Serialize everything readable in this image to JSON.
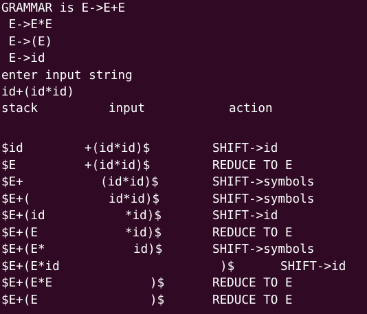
{
  "terminal": {
    "header_lines": [
      "GRAMMAR is E->E+E",
      " E->E*E",
      " E->(E)",
      " E->id",
      "enter input string",
      "id+(id*id)"
    ],
    "columns": {
      "stack": "stack",
      "input": "input",
      "action": "action"
    },
    "rows": [
      {
        "stack": "$id",
        "input": "+(id*id)$",
        "action": "SHIFT->id"
      },
      {
        "stack": "$E",
        "input": "+(id*id)$",
        "action": "REDUCE TO E"
      },
      {
        "stack": "$E+",
        "input": "(id*id)$",
        "action": "SHIFT->symbols"
      },
      {
        "stack": "$E+(",
        "input": "id*id)$",
        "action": "SHIFT->symbols"
      },
      {
        "stack": "$E+(id",
        "input": "*id)$",
        "action": "SHIFT->id"
      },
      {
        "stack": "$E+(E",
        "input": "*id)$",
        "action": "REDUCE TO E"
      },
      {
        "stack": "$E+(E*",
        "input": "id)$",
        "action": "SHIFT->symbols"
      },
      {
        "stack": "$E+(E*id",
        "input": ")$",
        "action": "SHIFT->id"
      },
      {
        "stack": "$E+(E*E",
        "input": ")$",
        "action": "REDUCE TO E"
      },
      {
        "stack": "$E+(E",
        "input": ")$",
        "action": "REDUCE TO E"
      }
    ]
  }
}
